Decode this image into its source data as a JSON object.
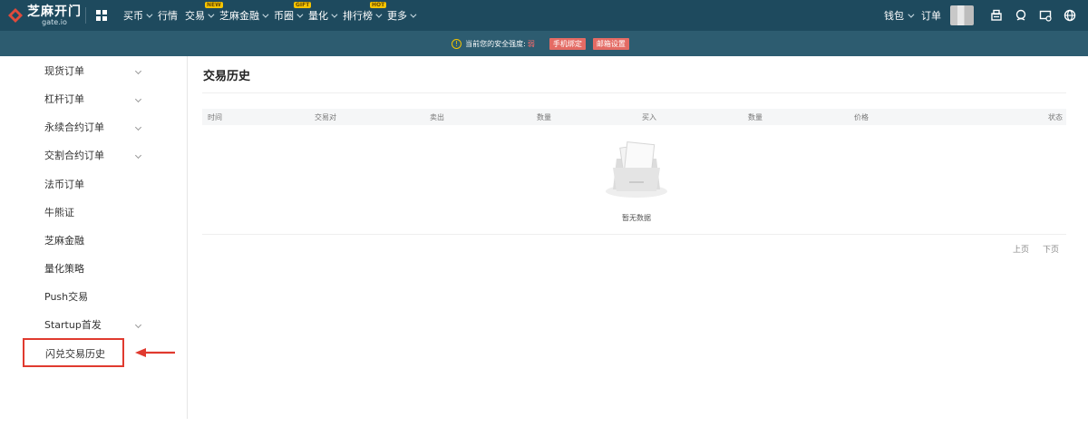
{
  "header": {
    "logo_cn": "芝麻开门",
    "logo_en": "gate.io",
    "nav": [
      {
        "label": "买币",
        "chevron": true,
        "badge": ""
      },
      {
        "label": "行情",
        "chevron": false,
        "badge": ""
      },
      {
        "label": "交易",
        "chevron": true,
        "badge": "NEW"
      },
      {
        "label": "芝麻金融",
        "chevron": true,
        "badge": ""
      },
      {
        "label": "币圈",
        "chevron": true,
        "badge": "GIFT"
      },
      {
        "label": "量化",
        "chevron": true,
        "badge": ""
      },
      {
        "label": "排行榜",
        "chevron": true,
        "badge": "HOT"
      },
      {
        "label": "更多",
        "chevron": true,
        "badge": ""
      }
    ],
    "wallet_label": "钱包",
    "orders_label": "订单",
    "icons": [
      "download-icon",
      "support-icon",
      "message-icon",
      "globe-icon"
    ],
    "bg_color": "#1e4a5e"
  },
  "notice": {
    "text": "当前您的安全强度:",
    "level": "弱",
    "buttons": [
      "手机绑定",
      "邮箱设置"
    ]
  },
  "sidebar": {
    "items": [
      {
        "label": "现货订单",
        "chevron": true
      },
      {
        "label": "杠杆订单",
        "chevron": true
      },
      {
        "label": "永续合约订单",
        "chevron": true
      },
      {
        "label": "交割合约订单",
        "chevron": true
      },
      {
        "label": "法币订单",
        "chevron": false
      },
      {
        "label": "牛熊证",
        "chevron": false
      },
      {
        "label": "芝麻金融",
        "chevron": false
      },
      {
        "label": "量化策略",
        "chevron": false
      },
      {
        "label": "Push交易",
        "chevron": false
      },
      {
        "label": "Startup首发",
        "chevron": true
      }
    ],
    "active_label": "闪兑交易历史",
    "highlight_color": "#e03a2f"
  },
  "main": {
    "title": "交易历史",
    "columns": [
      "时间",
      "交易对",
      "卖出",
      "数量",
      "买入",
      "数量",
      "价格",
      "状态"
    ],
    "empty_text": "暂无数据",
    "prev_label": "上页",
    "next_label": "下页"
  }
}
